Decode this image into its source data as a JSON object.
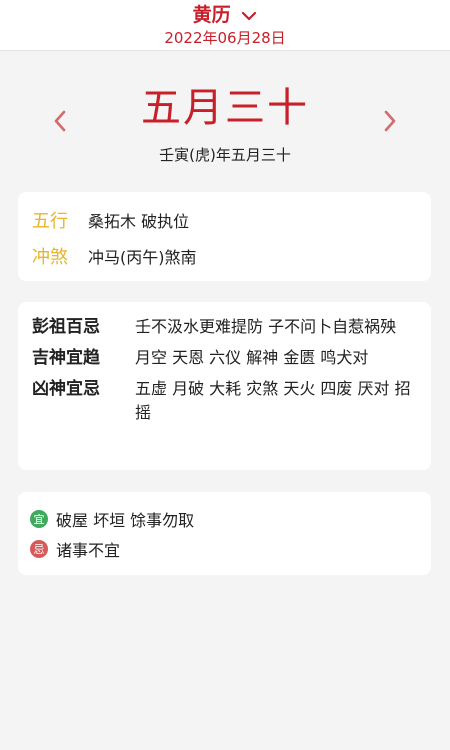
{
  "header": {
    "title": "黄历",
    "date": "2022年06月28日"
  },
  "lunar": {
    "date_big": "五月三十",
    "ganzhi": "壬寅(虎)年五月三十"
  },
  "info": {
    "wuxing_label": "五行",
    "wuxing_value": "桑拓木 破执位",
    "chongsha_label": "冲煞",
    "chongsha_value": "冲马(丙午)煞南"
  },
  "taboos": {
    "pengzu_label": "彭祖百忌",
    "pengzu_value": "壬不汲水更难提防 子不问卜自惹祸殃",
    "jishen_label": "吉神宜趋",
    "jishen_value": "月空 天恩 六仪 解神 金匮 鸣犬对",
    "xiongshen_label": "凶神宜忌",
    "xiongshen_value": "五虚 月破 大耗 灾煞 天火 四废 厌对 招摇"
  },
  "yiji": {
    "yi_badge": "宜",
    "yi_text": "破屋 坏垣 馀事勿取",
    "ji_badge": "忌",
    "ji_text": "诸事不宜"
  },
  "colors": {
    "accent": "#c8202a",
    "label_yellow": "#e8b42a",
    "yi_green": "#3daa5c",
    "ji_red": "#d65a5a"
  },
  "icons": {
    "dropdown": "chevron-down-icon",
    "prev": "chevron-left-icon",
    "next": "chevron-right-icon"
  }
}
